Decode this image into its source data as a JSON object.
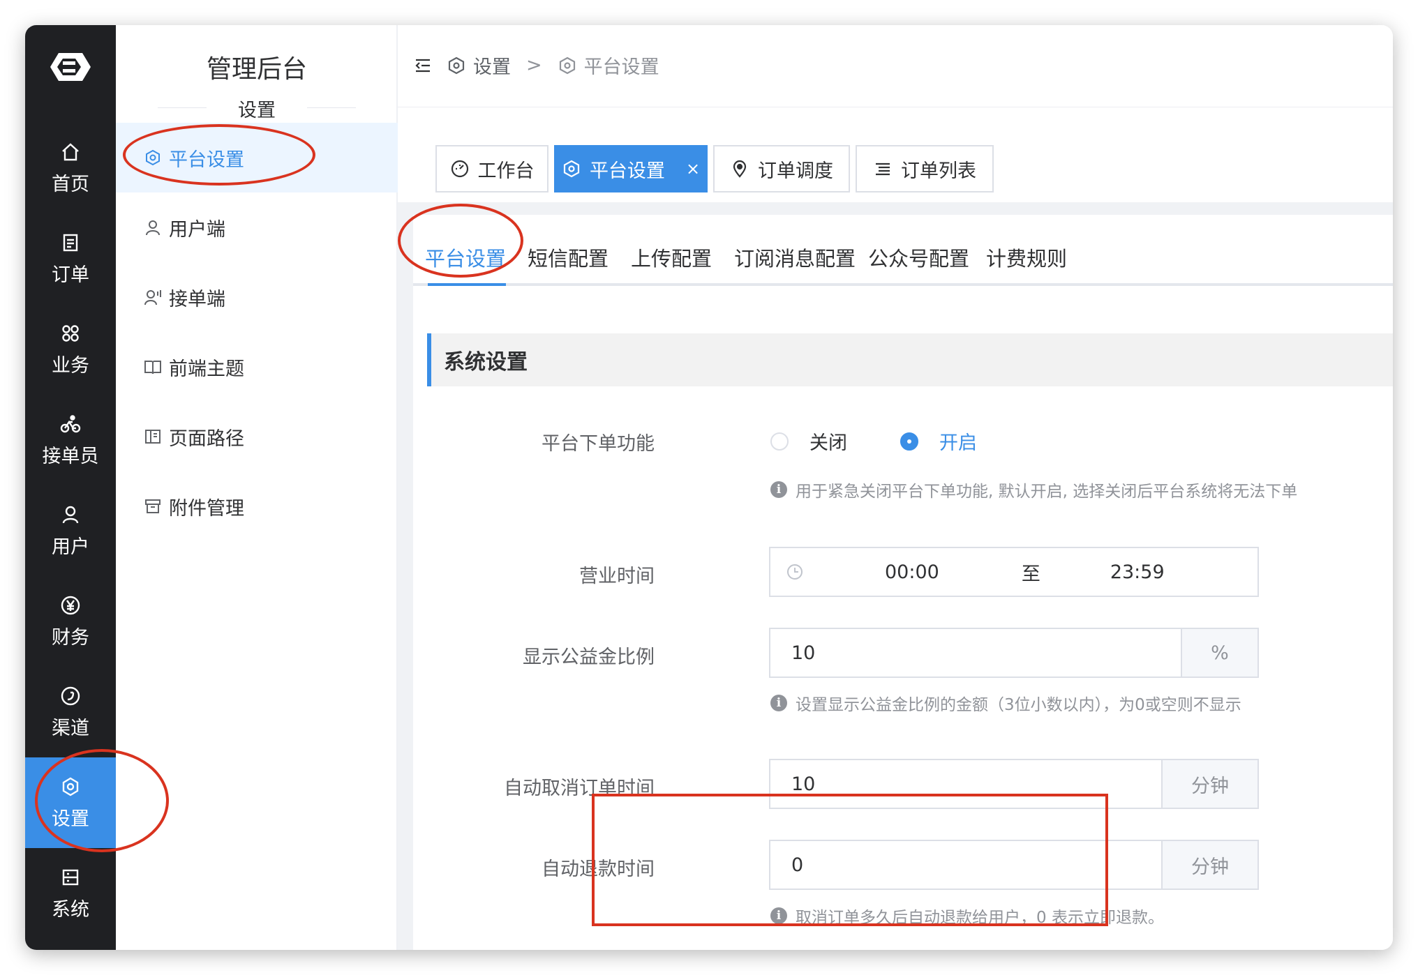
{
  "rail": [
    {
      "label": "首页",
      "icon": "home-icon"
    },
    {
      "label": "订单",
      "icon": "order-icon"
    },
    {
      "label": "业务",
      "icon": "business-icon"
    },
    {
      "label": "接单员",
      "icon": "bike-icon"
    },
    {
      "label": "用户",
      "icon": "user-icon"
    },
    {
      "label": "财务",
      "icon": "yen-icon"
    },
    {
      "label": "渠道",
      "icon": "channel-icon"
    },
    {
      "label": "设置",
      "icon": "settings-icon",
      "active": true
    },
    {
      "label": "系统",
      "icon": "system-icon"
    }
  ],
  "submenu": {
    "brand": "管理后台",
    "section": "设置",
    "items": [
      {
        "label": "平台设置",
        "icon": "settings-icon",
        "active": true
      },
      {
        "label": "用户端",
        "icon": "user-icon"
      },
      {
        "label": "接单端",
        "icon": "worker-icon"
      },
      {
        "label": "前端主题",
        "icon": "book-icon"
      },
      {
        "label": "页面路径",
        "icon": "layout-icon"
      },
      {
        "label": "附件管理",
        "icon": "archive-icon"
      }
    ]
  },
  "breadcrumb": {
    "parent": "设置",
    "separator": ">",
    "current": "平台设置"
  },
  "tags": [
    {
      "label": "工作台",
      "icon": "dashboard-icon"
    },
    {
      "label": "平台设置",
      "icon": "settings-icon",
      "active": true,
      "close": "×"
    },
    {
      "label": "订单调度",
      "icon": "location-icon"
    },
    {
      "label": "订单列表",
      "icon": "list-icon"
    }
  ],
  "tabs": [
    "平台设置",
    "短信配置",
    "上传配置",
    "订阅消息配置",
    "公众号配置",
    "计费规则"
  ],
  "panel": {
    "title": "系统设置",
    "order_switch": {
      "label": "平台下单功能",
      "options": [
        "关闭",
        "开启"
      ],
      "selected": "开启",
      "hint": "用于紧急关闭平台下单功能, 默认开启, 选择关闭后平台系统将无法下单"
    },
    "business_hours": {
      "label": "营业时间",
      "start": "00:00",
      "to": "至",
      "end": "23:59"
    },
    "charity_ratio": {
      "label": "显示公益金比例",
      "value": "10",
      "unit": "%",
      "hint": "设置显示公益金比例的金额（3位小数以内），为0或空则不显示"
    },
    "auto_cancel": {
      "label": "自动取消订单时间",
      "value": "10",
      "unit": "分钟"
    },
    "auto_refund": {
      "label": "自动退款时间",
      "value": "0",
      "unit": "分钟",
      "hint": "取消订单多久后自动退款给用户，0 表示立即退款。"
    }
  },
  "colors": {
    "accent": "#3a8ee6",
    "rail_bg": "#1f2023",
    "annotation": "#d9331f"
  }
}
